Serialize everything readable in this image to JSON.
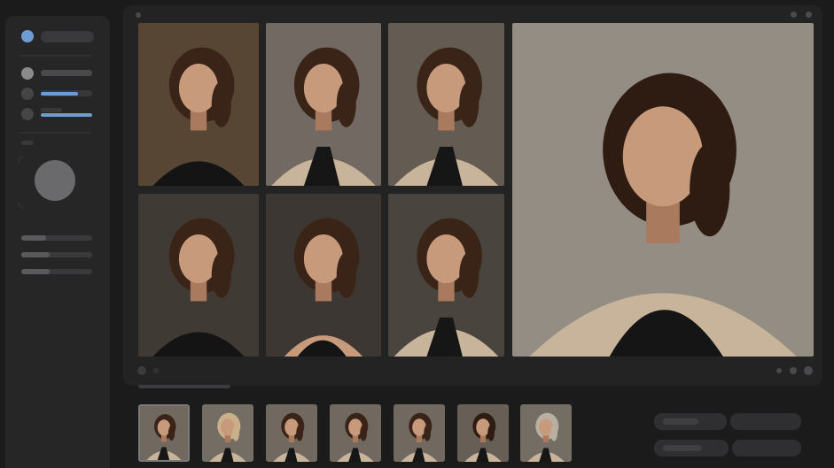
{
  "app": {
    "title": ""
  },
  "colors": {
    "accent": "#6e9bd1",
    "background": "#1b1b1c",
    "panel": "#232324",
    "sidebar": "#262627"
  },
  "sidebar": {
    "items": [
      {
        "icon": "circle-accent-icon",
        "label": ""
      },
      {
        "icon": "circle-icon",
        "label": ""
      },
      {
        "icon": "circle-icon",
        "label": "",
        "progress": 0.72
      },
      {
        "icon": "circle-icon",
        "label": "",
        "progress": 0.78
      }
    ],
    "dial": {
      "icon": "dial-knob-icon"
    },
    "sliders": [
      {
        "value": 0.35
      },
      {
        "value": 0.4
      },
      {
        "value": 0.4
      }
    ]
  },
  "grid": {
    "photos": [
      {
        "name": "portrait-1",
        "bg": "#6b5640",
        "outfit": "black-top"
      },
      {
        "name": "portrait-2",
        "bg": "#8a8178",
        "outfit": "beige-coat"
      },
      {
        "name": "portrait-3",
        "bg": "#7a6f64",
        "outfit": "beige-coat"
      },
      {
        "name": "portrait-4",
        "bg": "#4e473f",
        "outfit": "black-top"
      },
      {
        "name": "portrait-5",
        "bg": "#4a443e",
        "outfit": "black-tank"
      },
      {
        "name": "portrait-6",
        "bg": "#5a534c",
        "outfit": "beige-coat"
      }
    ],
    "featured": {
      "name": "portrait-featured",
      "bg": "#b5aca0",
      "outfit": "beige-coat-black-tank"
    }
  },
  "filmstrip": {
    "thumbs": [
      {
        "bg": "#8a8075",
        "hair": "#3a2418",
        "selected": true
      },
      {
        "bg": "#8e857a",
        "hair": "#c9b08a",
        "selected": false
      },
      {
        "bg": "#8a8075",
        "hair": "#3a2418",
        "selected": false
      },
      {
        "bg": "#8a8075",
        "hair": "#3a2418",
        "selected": false
      },
      {
        "bg": "#8a8075",
        "hair": "#3a2418",
        "selected": false
      },
      {
        "bg": "#7e756a",
        "hair": "#2e1c12",
        "selected": false
      },
      {
        "bg": "#8e857a",
        "hair": "#b9b0a2",
        "selected": false
      }
    ]
  },
  "actions": [
    {
      "label": ""
    },
    {
      "label": ""
    },
    {
      "label": ""
    },
    {
      "label": ""
    }
  ]
}
